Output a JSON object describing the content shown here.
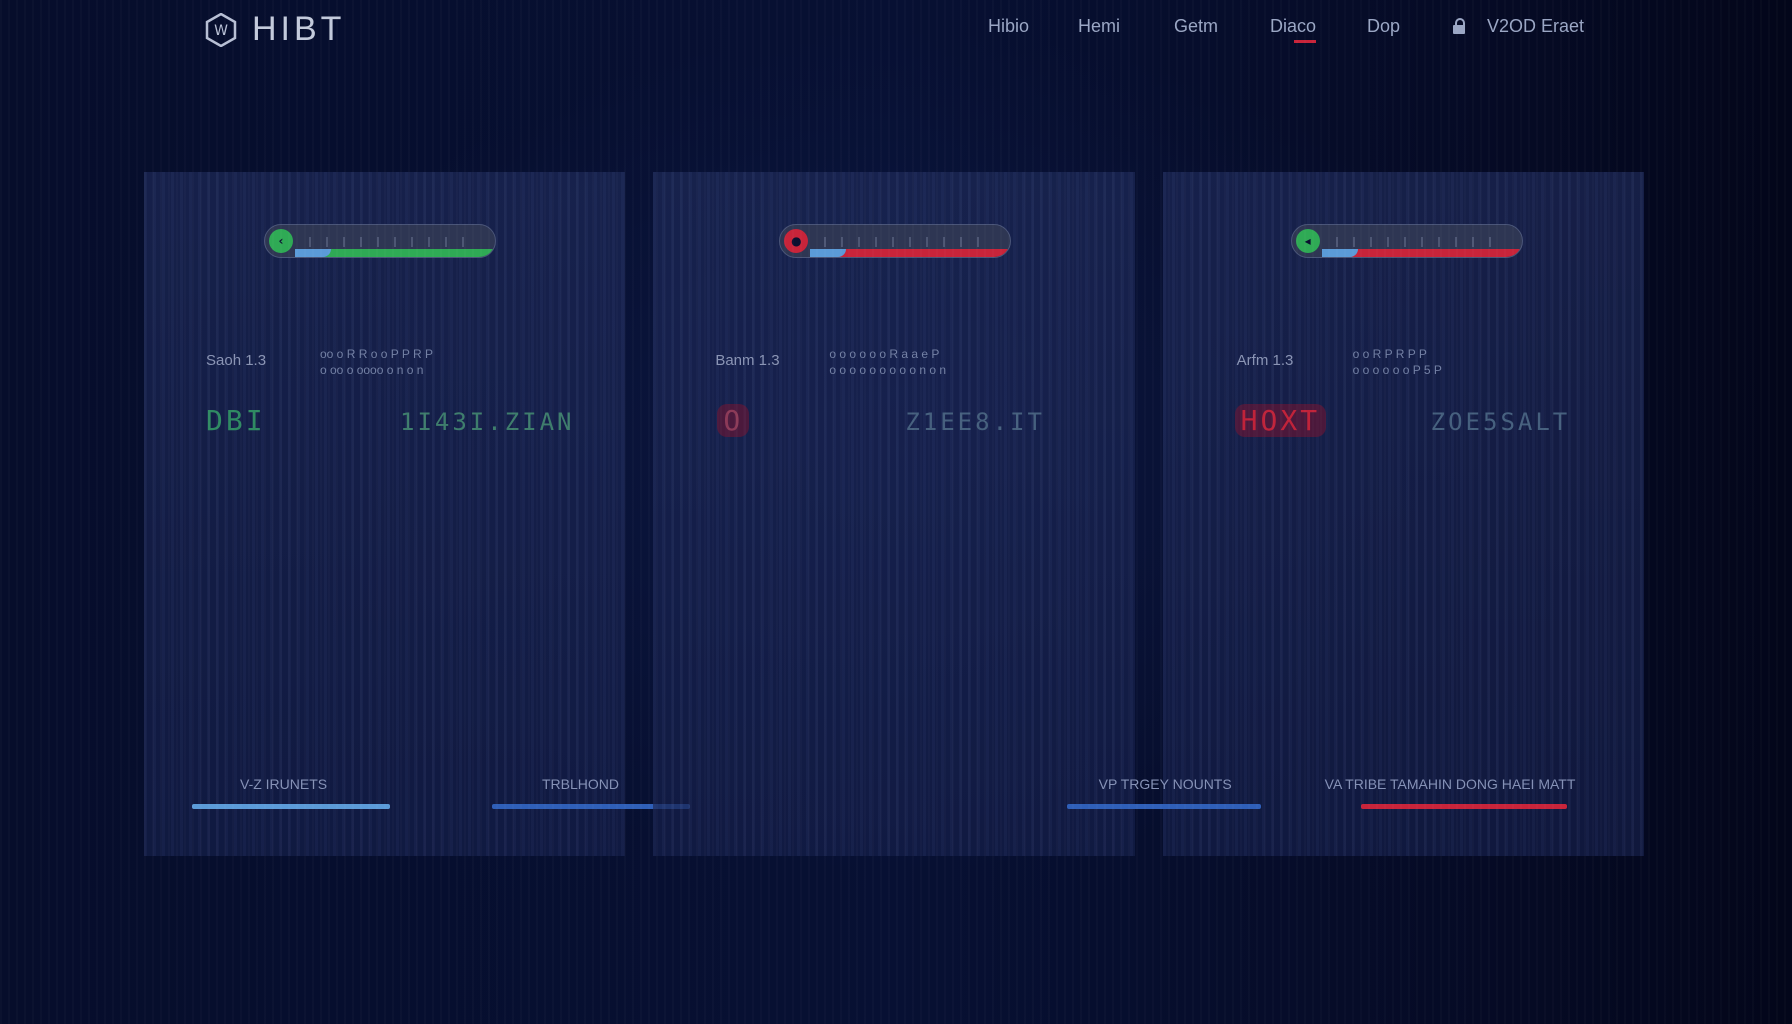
{
  "header": {
    "brand": "HIBT",
    "nav": [
      "Hibio",
      "Hemi",
      "Getm",
      "Diaco",
      "Dop"
    ],
    "active_nav": "Diaco",
    "account_label": "V2OD Eraet"
  },
  "panels": [
    {
      "status_color": "#2faa55",
      "label": "Saoh 1.3",
      "sub": [
        "oo o R R o o  P P R P",
        "o oo o  oooo  o  n o n"
      ],
      "code_left": "DBI",
      "code_left_color": "#2f8a62",
      "code_right": "1I43I.ZIAN",
      "link_left": "V-Z IRUNETS",
      "link_right": "TRBLHOND"
    },
    {
      "status_color": "#c8243a",
      "label": "Banm 1.3",
      "sub": [
        "o o o o o o  R a a e P",
        "o o o o  o o o o  o  n o n"
      ],
      "code_left": "O",
      "code_left_color": "#8c3a58",
      "code_right": "Z1EE8.IT",
      "link_left": "",
      "link_right": ""
    },
    {
      "status_color": "#2faa55",
      "label": "Arfm 1.3",
      "sub": [
        "o o R P R P P",
        "o o o  o o o  P 5 P"
      ],
      "code_left": "HOXT",
      "code_left_color": "#c0233a",
      "code_right": "ZOE5SALT",
      "link_left": "VP TRGEY NOUNTS",
      "link_right": "VA TRIBE TAMAHIN DONG HAEI MATT"
    }
  ],
  "accent": {
    "green": "#2faa55",
    "red": "#c8243a",
    "blue": "#3e74c8",
    "lightblue": "#5b9bd8"
  }
}
